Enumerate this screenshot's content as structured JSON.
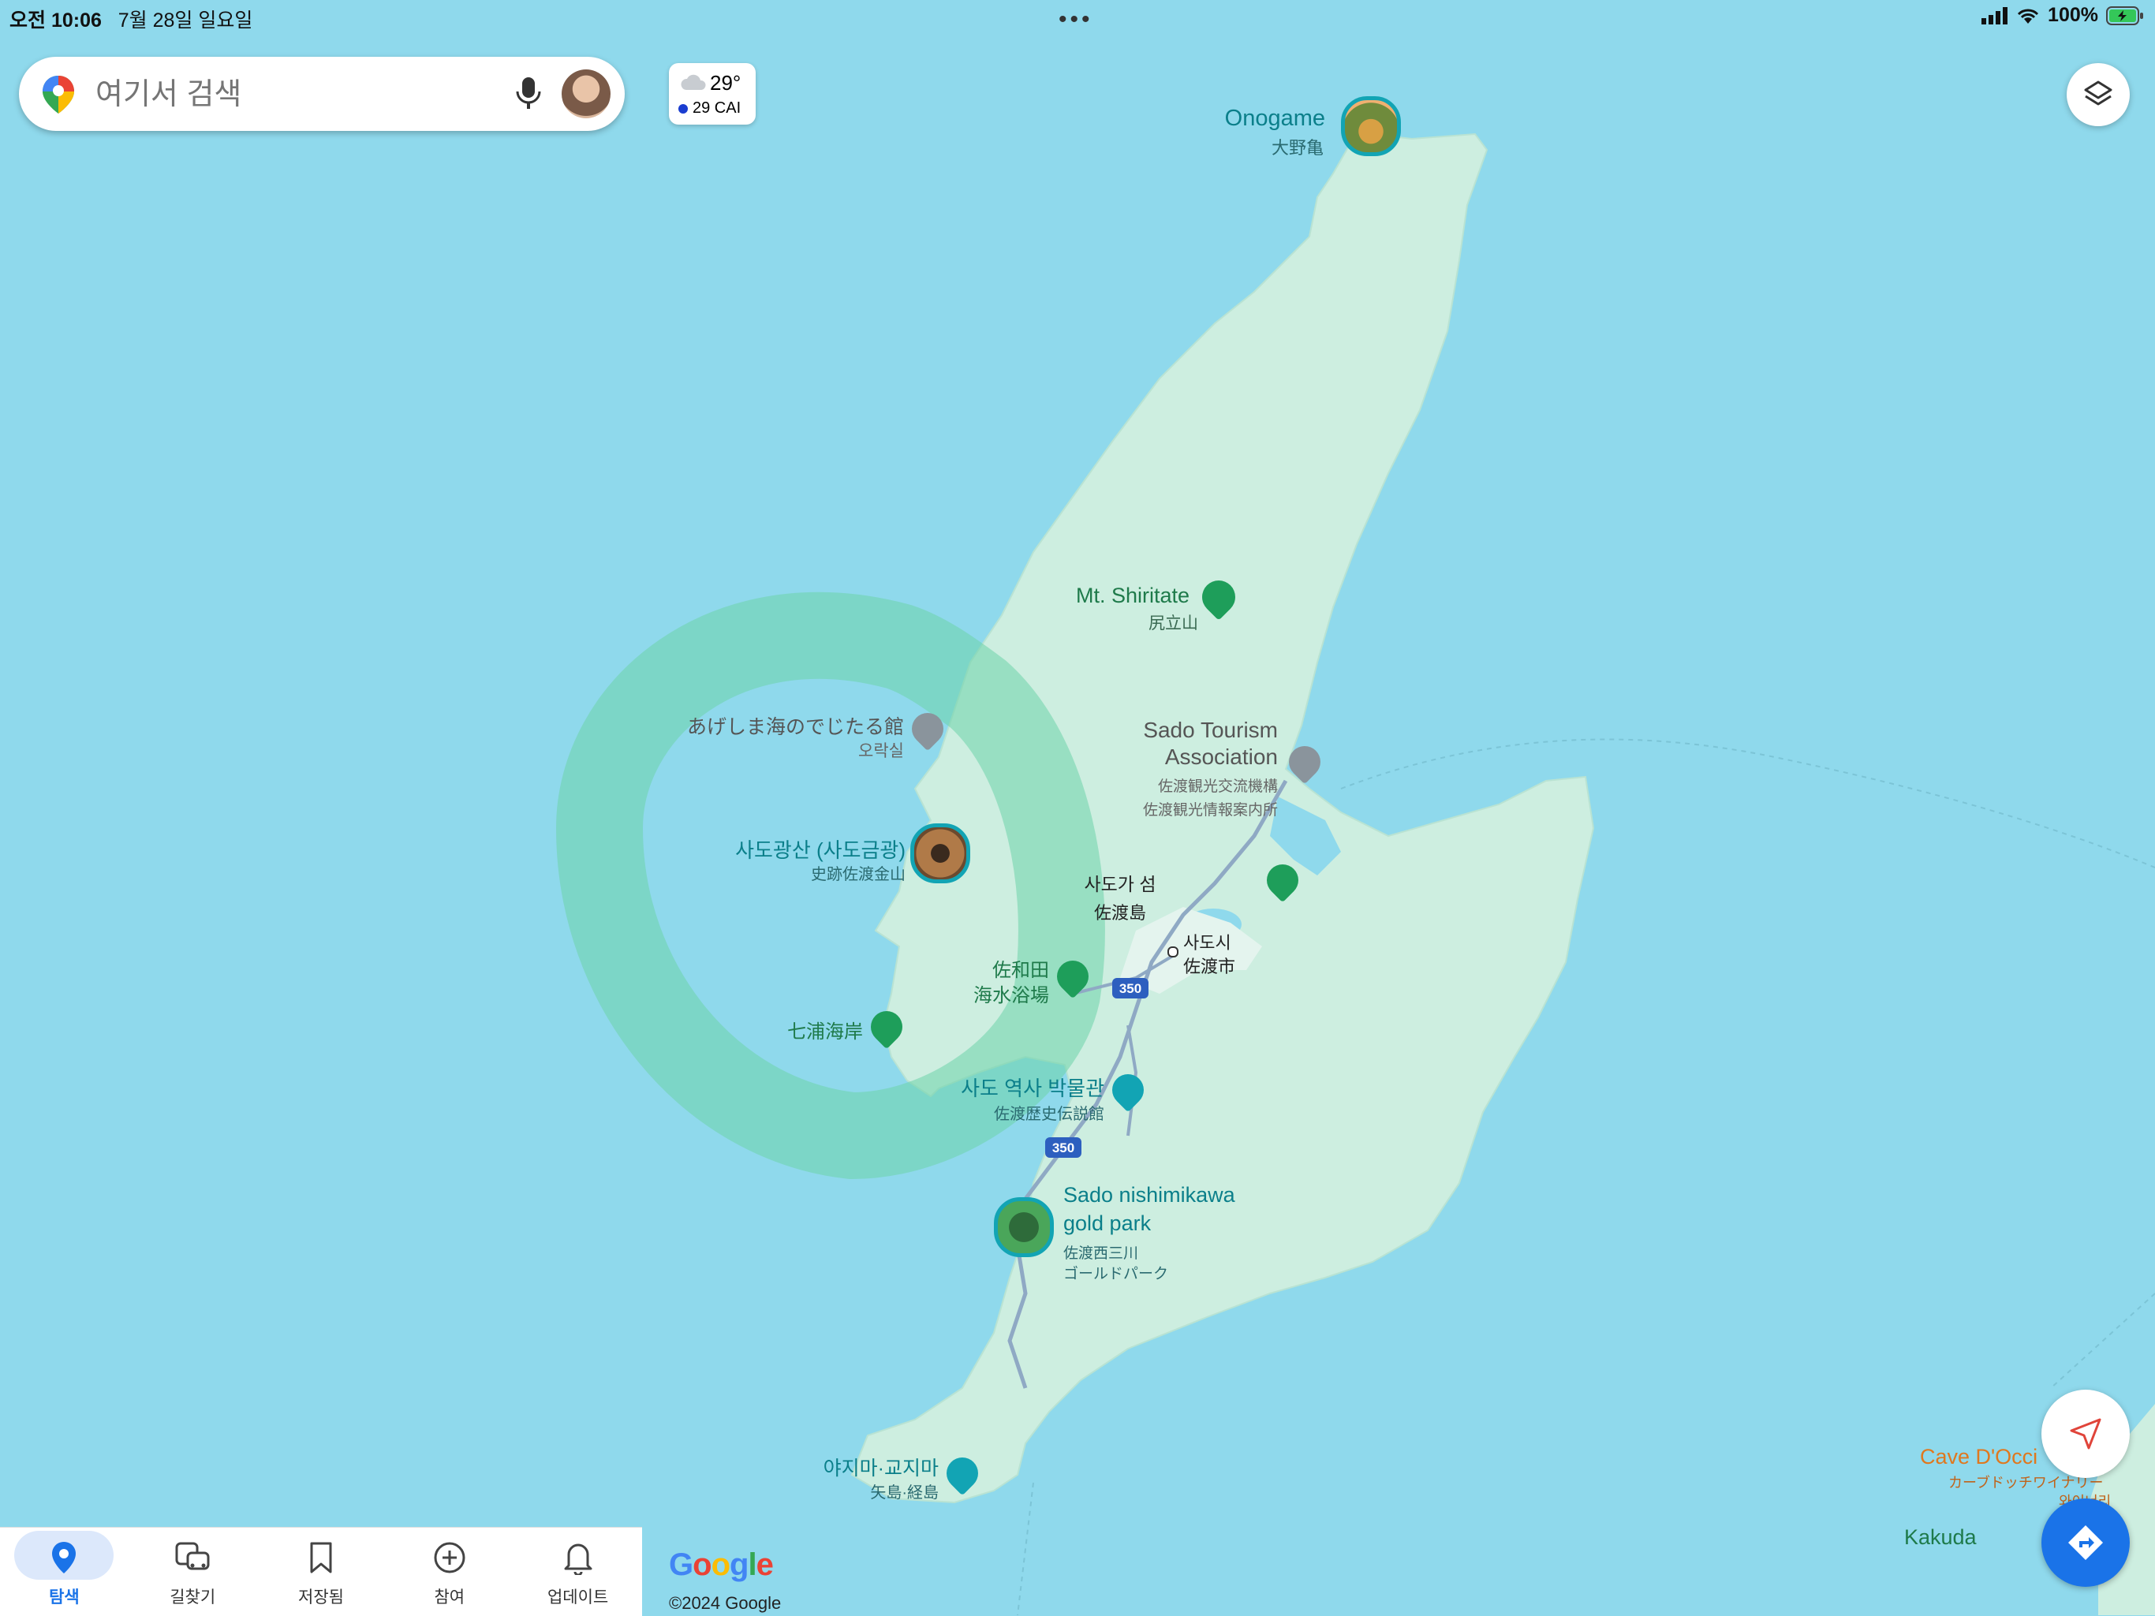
{
  "status_bar": {
    "time": "오전 10:06",
    "date": "7월 28일 일요일",
    "battery": "100%"
  },
  "search": {
    "placeholder": "여기서 검색"
  },
  "weather": {
    "temperature": "29°",
    "aqi": "29 CAI"
  },
  "map": {
    "places": [
      {
        "name": "Onogame",
        "sub": "大野亀"
      },
      {
        "name": "Mt. Shiritate",
        "sub": "尻立山"
      },
      {
        "name": "あげしま海のでじたる館",
        "sub": "오락실"
      },
      {
        "name_line1": "Sado Tourism",
        "name_line2": "Association",
        "sub1": "佐渡観光交流機構",
        "sub2": "佐渡観光情報案内所"
      },
      {
        "name": "사도광산 (사도금광)",
        "sub": "史跡佐渡金山"
      },
      {
        "name": "사도가 섬",
        "sub": "佐渡島"
      },
      {
        "name": "사도시",
        "sub": "佐渡市"
      },
      {
        "name_line1": "佐和田",
        "name_line2": "海水浴場"
      },
      {
        "name": "七浦海岸"
      },
      {
        "name": "사도 역사 박물관",
        "sub": "佐渡歴史伝説館"
      },
      {
        "name_line1": "Sado nishimikawa",
        "name_line2": "gold park",
        "sub1": "佐渡西三川",
        "sub2": "ゴールドパーク"
      },
      {
        "name": "야지마·교지마",
        "sub": "矢島·経島"
      },
      {
        "name": "Cave D'Occi",
        "sub1": "カーブドッチワイナリー",
        "sub2": "와이너리"
      },
      {
        "name": "Kakuda"
      }
    ],
    "route_shields": [
      "350",
      "350"
    ],
    "colors": {
      "sea": "#8fd9ec",
      "land": "#cdeee0",
      "accent": "#1a73e8",
      "poi_green": "#1e9e5a",
      "poi_teal": "#12a4b4"
    }
  },
  "bottom_nav": {
    "items": [
      {
        "label": "탐색",
        "icon": "location-pin-icon",
        "active": true
      },
      {
        "label": "길찾기",
        "icon": "commute-icon"
      },
      {
        "label": "저장됨",
        "icon": "bookmark-icon"
      },
      {
        "label": "참여",
        "icon": "add-circle-icon"
      },
      {
        "label": "업데이트",
        "icon": "bell-icon"
      }
    ]
  },
  "attribution": {
    "logo": "Google",
    "copyright": "©2024 Google"
  }
}
